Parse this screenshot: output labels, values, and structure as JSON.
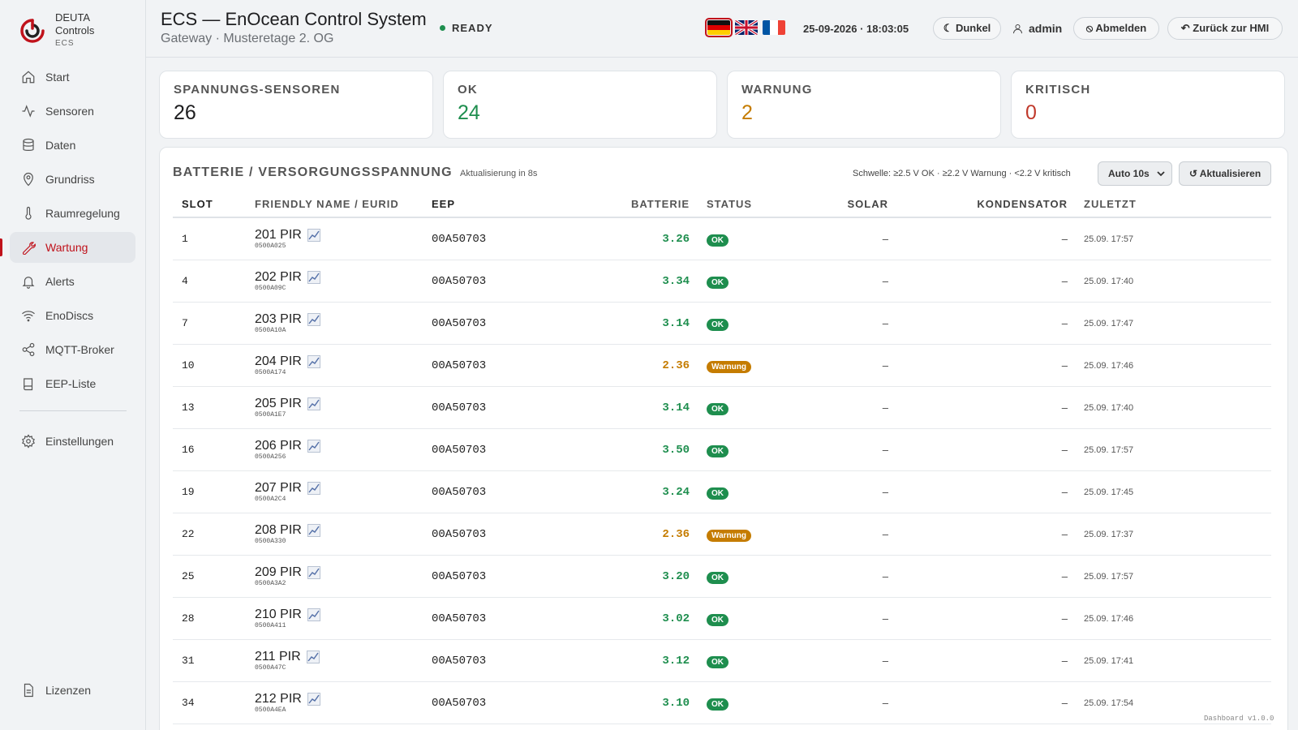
{
  "brand": {
    "name": "DEUTA",
    "sub": "Controls",
    "tiny": "ECS"
  },
  "nav": [
    {
      "label": "Start",
      "icon": "home-icon"
    },
    {
      "label": "Sensoren",
      "icon": "activity-icon"
    },
    {
      "label": "Daten",
      "icon": "database-icon"
    },
    {
      "label": "Grundriss",
      "icon": "map-pin-icon"
    },
    {
      "label": "Raumregelung",
      "icon": "thermometer-icon"
    },
    {
      "label": "Wartung",
      "icon": "wrench-icon",
      "active": true
    },
    {
      "label": "Alerts",
      "icon": "bell-icon"
    },
    {
      "label": "EnoDiscs",
      "icon": "wifi-icon"
    },
    {
      "label": "MQTT-Broker",
      "icon": "share-icon"
    },
    {
      "label": "EEP-Liste",
      "icon": "book-icon"
    },
    {
      "label": "Einstellungen",
      "icon": "gear-icon"
    }
  ],
  "nav_bottom": {
    "label": "Lizenzen",
    "icon": "file-icon"
  },
  "header": {
    "title": "ECS — EnOcean Control System",
    "subtitle": "Gateway · Musteretage 2. OG",
    "status": "READY",
    "datetime": "25-09-2026 · 18:03:05",
    "theme_label": "☾ Dunkel",
    "user": "admin",
    "logout_label": "⦸ Abmelden",
    "back_label": "↶ Zurück zur HMI",
    "languages": [
      "de",
      "en",
      "fr"
    ],
    "active_language": "de"
  },
  "stats": [
    {
      "label": "SPANNUNGS-SENSOREN",
      "value": "26",
      "color": "#1d1d1f"
    },
    {
      "label": "OK",
      "value": "24",
      "color": "#1e8e4e"
    },
    {
      "label": "WARNUNG",
      "value": "2",
      "color": "#c57c00"
    },
    {
      "label": "KRITISCH",
      "value": "0",
      "color": "#c0392b"
    }
  ],
  "panel": {
    "title": "BATTERIE / VERSORGUNGSSPANNUNG",
    "refresh_info": "Aktualisierung in 8s",
    "threshold": "Schwelle: ≥2.5 V OK · ≥2.2 V Warnung · <2.2 V kritisch",
    "auto_select": "Auto 10s",
    "refresh_label": "↺ Aktualisieren"
  },
  "table": {
    "columns": [
      "SLOT",
      "FRIENDLY NAME / EURID",
      "EEP",
      "BATTERIE",
      "STATUS",
      "SOLAR",
      "KONDENSATOR",
      "ZULETZT"
    ],
    "rows": [
      {
        "slot": "1",
        "name": "201 PIR",
        "eurid": "0500A025",
        "eep": "00A50703",
        "battery": "3.26",
        "status": "OK",
        "solar": "–",
        "kondensator": "–",
        "last": "25.09. 17:57"
      },
      {
        "slot": "4",
        "name": "202 PIR",
        "eurid": "0500A09C",
        "eep": "00A50703",
        "battery": "3.34",
        "status": "OK",
        "solar": "–",
        "kondensator": "–",
        "last": "25.09. 17:40"
      },
      {
        "slot": "7",
        "name": "203 PIR",
        "eurid": "0500A10A",
        "eep": "00A50703",
        "battery": "3.14",
        "status": "OK",
        "solar": "–",
        "kondensator": "–",
        "last": "25.09. 17:47"
      },
      {
        "slot": "10",
        "name": "204 PIR",
        "eurid": "0500A174",
        "eep": "00A50703",
        "battery": "2.36",
        "status": "Warnung",
        "solar": "–",
        "kondensator": "–",
        "last": "25.09. 17:46"
      },
      {
        "slot": "13",
        "name": "205 PIR",
        "eurid": "0500A1E7",
        "eep": "00A50703",
        "battery": "3.14",
        "status": "OK",
        "solar": "–",
        "kondensator": "–",
        "last": "25.09. 17:40"
      },
      {
        "slot": "16",
        "name": "206 PIR",
        "eurid": "0500A256",
        "eep": "00A50703",
        "battery": "3.50",
        "status": "OK",
        "solar": "–",
        "kondensator": "–",
        "last": "25.09. 17:57"
      },
      {
        "slot": "19",
        "name": "207 PIR",
        "eurid": "0500A2C4",
        "eep": "00A50703",
        "battery": "3.24",
        "status": "OK",
        "solar": "–",
        "kondensator": "–",
        "last": "25.09. 17:45"
      },
      {
        "slot": "22",
        "name": "208 PIR",
        "eurid": "0500A330",
        "eep": "00A50703",
        "battery": "2.36",
        "status": "Warnung",
        "solar": "–",
        "kondensator": "–",
        "last": "25.09. 17:37"
      },
      {
        "slot": "25",
        "name": "209 PIR",
        "eurid": "0500A3A2",
        "eep": "00A50703",
        "battery": "3.20",
        "status": "OK",
        "solar": "–",
        "kondensator": "–",
        "last": "25.09. 17:57"
      },
      {
        "slot": "28",
        "name": "210 PIR",
        "eurid": "0500A411",
        "eep": "00A50703",
        "battery": "3.02",
        "status": "OK",
        "solar": "–",
        "kondensator": "–",
        "last": "25.09. 17:46"
      },
      {
        "slot": "31",
        "name": "211 PIR",
        "eurid": "0500A47C",
        "eep": "00A50703",
        "battery": "3.12",
        "status": "OK",
        "solar": "–",
        "kondensator": "–",
        "last": "25.09. 17:41"
      },
      {
        "slot": "34",
        "name": "212 PIR",
        "eurid": "0500A4EA",
        "eep": "00A50703",
        "battery": "3.10",
        "status": "OK",
        "solar": "–",
        "kondensator": "–",
        "last": "25.09. 17:54"
      }
    ]
  },
  "colors": {
    "accent": "#c0121b",
    "ok": "#1e8e4e",
    "warning": "#c57c00",
    "critical": "#c0392b"
  },
  "version": "Dashboard v1.0.0"
}
